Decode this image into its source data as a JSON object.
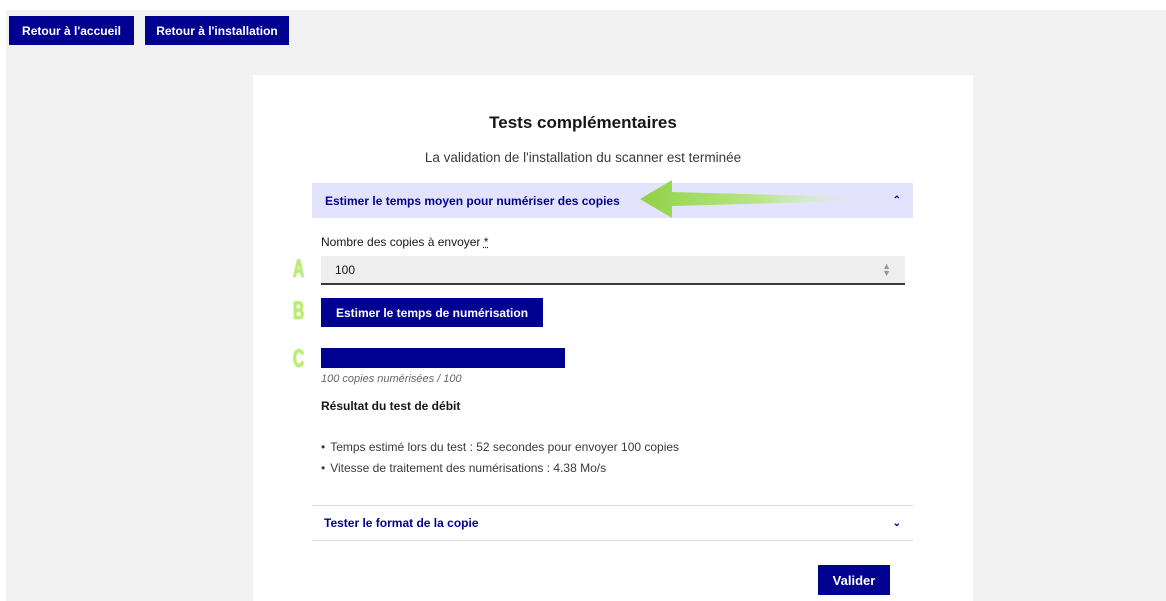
{
  "nav": {
    "home_label": "Retour à l'accueil",
    "install_label": "Retour à l'installation"
  },
  "card": {
    "title": "Tests complémentaires",
    "subtitle": "La validation de l'installation du scanner est terminée"
  },
  "accordion1": {
    "title": "Estimer le temps moyen pour numériser des copies",
    "expanded": true,
    "field_label": "Nombre des copies à envoyer",
    "field_required_mark": "*",
    "field_value": "100",
    "estimate_button": "Estimer le temps de numérisation",
    "progress_fraction": 1.0,
    "progress_text": "100 copies numérisées / 100",
    "result_title": "Résultat du test de débit",
    "results": [
      "Temps estimé lors du test : 52 secondes pour envoyer 100 copies",
      "Vitesse de traitement des numérisations : 4.38 Mo/s"
    ]
  },
  "accordion2": {
    "title": "Tester le format de la copie",
    "expanded": false
  },
  "submit_label": "Valider",
  "annotations": {
    "a": "A",
    "b": "B",
    "c": "C"
  },
  "icons": {
    "chevron_up": "chevron-up-icon",
    "chevron_down": "chevron-down-icon",
    "spin": "spinner-arrows-icon",
    "arrow": "green-arrow-annotation"
  },
  "colors": {
    "primary": "#000091",
    "accordion_bg": "#e3e3fd",
    "page_bg": "#f2f2f2",
    "annotation_green": "#b8f06a"
  }
}
